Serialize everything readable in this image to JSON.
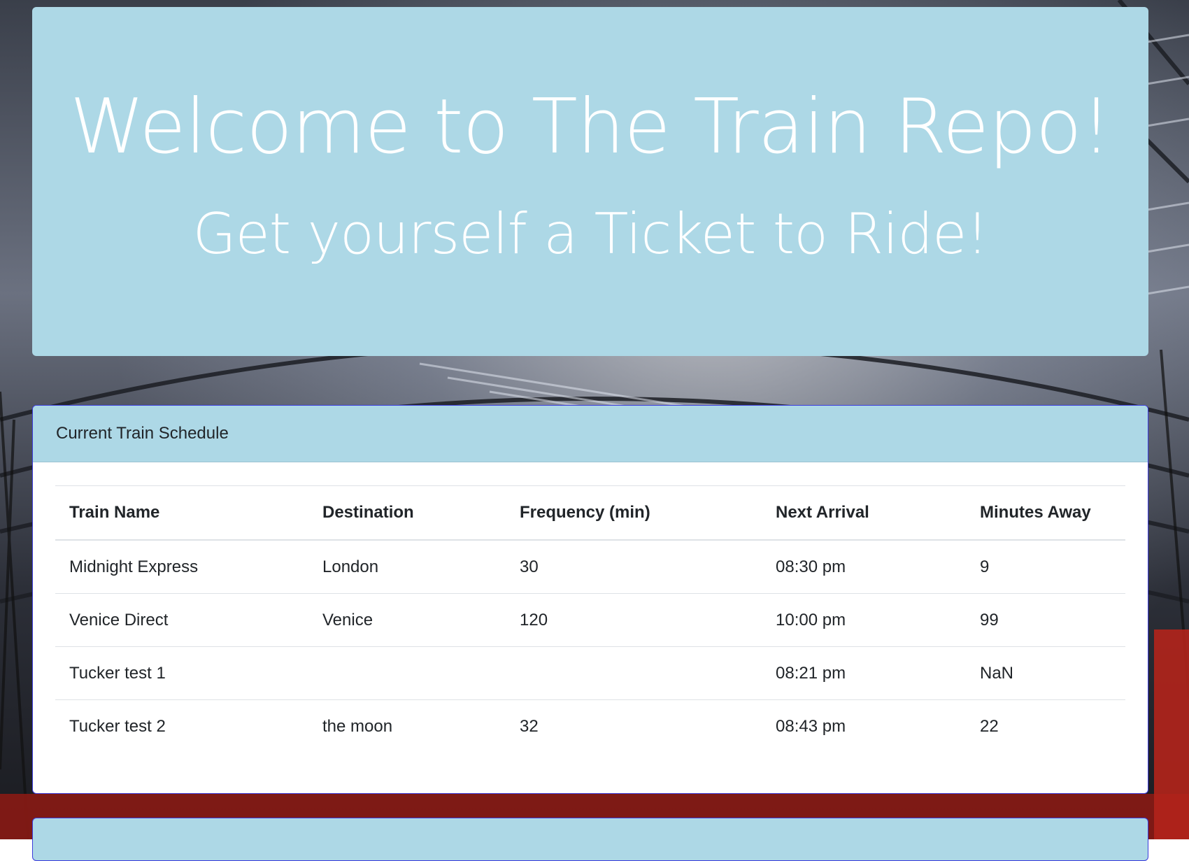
{
  "jumbotron": {
    "title": "Welcome to The Train Repo!",
    "subtitle": "Get yourself a Ticket to Ride!"
  },
  "schedule": {
    "header": "Current Train Schedule",
    "columns": [
      "Train Name",
      "Destination",
      "Frequency (min)",
      "Next Arrival",
      "Minutes Away"
    ],
    "rows": [
      [
        "Midnight Express",
        "London",
        "30",
        "08:30 pm",
        "9"
      ],
      [
        "Venice Direct",
        "Venice",
        "120",
        "10:00 pm",
        "99"
      ],
      [
        "Tucker test 1",
        "",
        "",
        "08:21 pm",
        "NaN"
      ],
      [
        "Tucker test 2",
        "the moon",
        "32",
        "08:43 pm",
        "22"
      ]
    ]
  },
  "colors": {
    "panel": "#add8e6",
    "card_border": "#3b3bdc",
    "text": "#212529"
  }
}
